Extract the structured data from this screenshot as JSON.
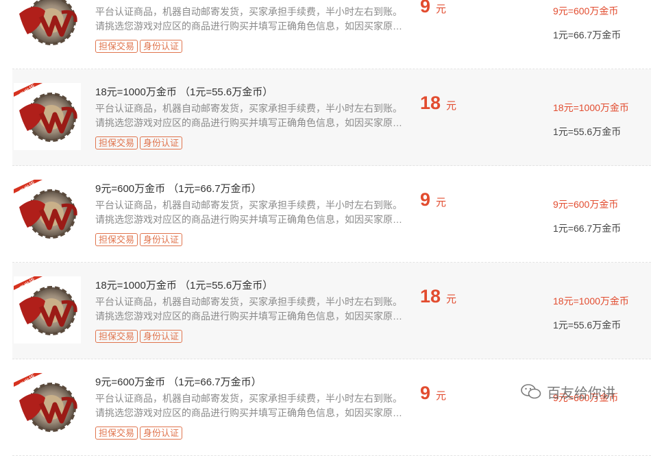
{
  "listings": [
    {
      "title": "",
      "desc_line1": "平台认证商品，机器自动邮寄发货，买家承担手续费，半小时左右到账。",
      "desc_line2": "请挑选您游戏对应区的商品进行购买并填写正确角色信息，如因买家原…",
      "tags": [
        "担保交易",
        "身份认证"
      ],
      "price": "9",
      "price_unit": "元",
      "rate_main": "9元=600万金币",
      "rate_unit": "1元=66.7万金币",
      "badge": ""
    },
    {
      "title": "18元=1000万金币 （1元=55.6万金币）",
      "desc_line1": "平台认证商品，机器自动邮寄发货，买家承担手续费，半小时左右到账。",
      "desc_line2": "请挑选您游戏对应区的商品进行购买并填写正确角色信息，如因买家原…",
      "tags": [
        "担保交易",
        "身份认证"
      ],
      "price": "18",
      "price_unit": "元",
      "rate_main": "18元=1000万金币",
      "rate_unit": "1元=55.6万金币",
      "badge": "邮寄发货"
    },
    {
      "title": "9元=600万金币 （1元=66.7万金币）",
      "desc_line1": "平台认证商品，机器自动邮寄发货，买家承担手续费，半小时左右到账。",
      "desc_line2": "请挑选您游戏对应区的商品进行购买并填写正确角色信息，如因买家原…",
      "tags": [
        "担保交易",
        "身份认证"
      ],
      "price": "9",
      "price_unit": "元",
      "rate_main": "9元=600万金币",
      "rate_unit": "1元=66.7万金币",
      "badge": "邮寄发货"
    },
    {
      "title": "18元=1000万金币 （1元=55.6万金币）",
      "desc_line1": "平台认证商品，机器自动邮寄发货，买家承担手续费，半小时左右到账。",
      "desc_line2": "请挑选您游戏对应区的商品进行购买并填写正确角色信息，如因买家原…",
      "tags": [
        "担保交易",
        "身份认证"
      ],
      "price": "18",
      "price_unit": "元",
      "rate_main": "18元=1000万金币",
      "rate_unit": "1元=55.6万金币",
      "badge": "邮寄发货"
    },
    {
      "title": "9元=600万金币 （1元=66.7万金币）",
      "desc_line1": "平台认证商品，机器自动邮寄发货，买家承担手续费，半小时左右到账。",
      "desc_line2": "请挑选您游戏对应区的商品进行购买并填写正确角色信息，如因买家原…",
      "tags": [
        "担保交易",
        "身份认证"
      ],
      "price": "9",
      "price_unit": "元",
      "rate_main": "9元=600万金币",
      "rate_unit": "",
      "badge": "邮寄发货"
    }
  ],
  "watermark": {
    "text": "百友给你讲",
    "icon": "wechat-icon"
  },
  "colors": {
    "accent": "#e24c2f",
    "tag": "#e0744d",
    "alt_row": "#f7f7f7"
  }
}
